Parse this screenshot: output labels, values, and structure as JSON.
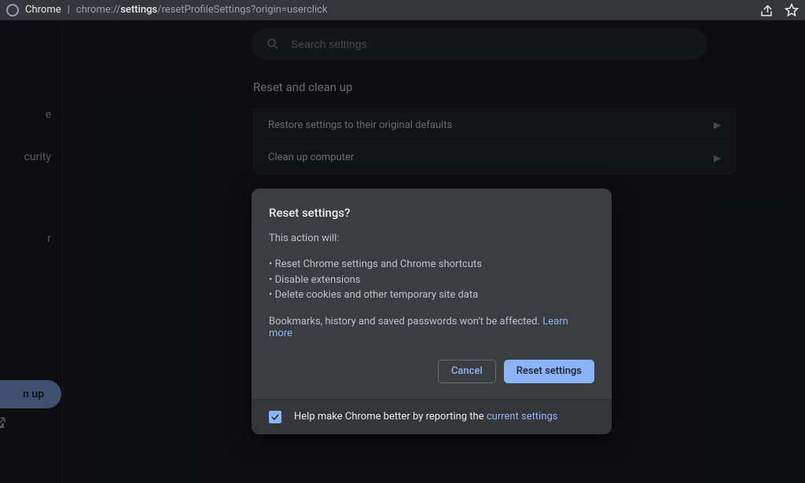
{
  "browser_bar": {
    "app_name": "Chrome",
    "url_prefix": "chrome://",
    "url_host": "settings",
    "url_rest": "/resetProfileSettings?origin=userclick"
  },
  "search": {
    "placeholder": "Search settings"
  },
  "sidebar": {
    "items": [
      "e",
      "curity",
      "r"
    ],
    "button_label": "n up"
  },
  "section": {
    "title": "Reset and clean up",
    "rows": [
      "Restore settings to their original defaults",
      "Clean up computer"
    ]
  },
  "dialog": {
    "title": "Reset settings?",
    "intro": "This action will:",
    "bullets": [
      "• Reset Chrome settings and Chrome shortcuts",
      "• Disable extensions",
      "• Delete cookies and other temporary site data"
    ],
    "note_prefix": "Bookmarks, history and saved passwords won't be affected. ",
    "learn_more": "Learn more",
    "cancel": "Cancel",
    "confirm": "Reset settings",
    "checkbox_label_prefix": "Help make Chrome better by reporting the ",
    "checkbox_link": "current settings",
    "checkbox_checked": true
  },
  "colors": {
    "accent": "#8ab4f8"
  }
}
